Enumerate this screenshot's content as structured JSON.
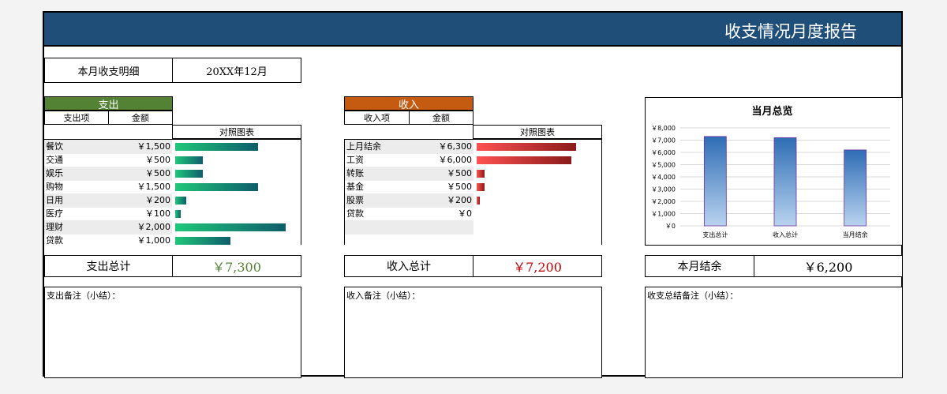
{
  "header": {
    "title": "收支情况月度报告"
  },
  "period": {
    "label": "本月收支明细",
    "value": "20XX年12月"
  },
  "expense": {
    "section_title": "支出",
    "col_item": "支出项",
    "col_amount": "金额",
    "col_chart": "对照图表",
    "items": [
      {
        "label": "餐饮",
        "amount_text": "￥1,500",
        "amount": 1500
      },
      {
        "label": "交通",
        "amount_text": "￥500",
        "amount": 500
      },
      {
        "label": "娱乐",
        "amount_text": "￥500",
        "amount": 500
      },
      {
        "label": "购物",
        "amount_text": "￥1,500",
        "amount": 1500
      },
      {
        "label": "日用",
        "amount_text": "￥200",
        "amount": 200
      },
      {
        "label": "医疗",
        "amount_text": "￥100",
        "amount": 100
      },
      {
        "label": "理财",
        "amount_text": "￥2,000",
        "amount": 2000
      },
      {
        "label": "贷款",
        "amount_text": "￥1,000",
        "amount": 1000
      }
    ],
    "total_label": "支出总计",
    "total_value": "￥7,300",
    "note_label": "支出备注（小结）："
  },
  "income": {
    "section_title": "收入",
    "col_item": "收入项",
    "col_amount": "金额",
    "col_chart": "对照图表",
    "items": [
      {
        "label": "上月结余",
        "amount_text": "￥6,300",
        "amount": 6300
      },
      {
        "label": "工资",
        "amount_text": "￥6,000",
        "amount": 6000
      },
      {
        "label": "转账",
        "amount_text": "￥500",
        "amount": 500
      },
      {
        "label": "基金",
        "amount_text": "￥500",
        "amount": 500
      },
      {
        "label": "股票",
        "amount_text": "￥200",
        "amount": 200
      },
      {
        "label": "贷款",
        "amount_text": "￥0",
        "amount": 0
      }
    ],
    "total_label": "收入总计",
    "total_value": "￥7,200",
    "note_label": "收入备注（小结）："
  },
  "summary": {
    "balance_label": "本月结余",
    "balance_value": "￥6,200",
    "note_label": "收支总结备注（小结）："
  },
  "colors": {
    "header_bg": "#1f4e79",
    "expense_head": "#548235",
    "income_head": "#c55a11",
    "expense_total": "#548235",
    "income_total": "#c00000",
    "chart_bar_top": "#2f6db5",
    "chart_bar_bottom": "#b9d3ef"
  },
  "chart_data": {
    "type": "bar",
    "title": "当月总览",
    "categories": [
      "支出总计",
      "收入总计",
      "当月结余"
    ],
    "values": [
      7300,
      7200,
      6200
    ],
    "ylim": [
      0,
      8000
    ],
    "yticks": [
      "￥0",
      "￥1,000",
      "￥2,000",
      "￥3,000",
      "￥4,000",
      "￥5,000",
      "￥6,000",
      "￥7,000",
      "￥8,000"
    ],
    "ytick_values": [
      0,
      1000,
      2000,
      3000,
      4000,
      5000,
      6000,
      7000,
      8000
    ],
    "grid": true
  }
}
